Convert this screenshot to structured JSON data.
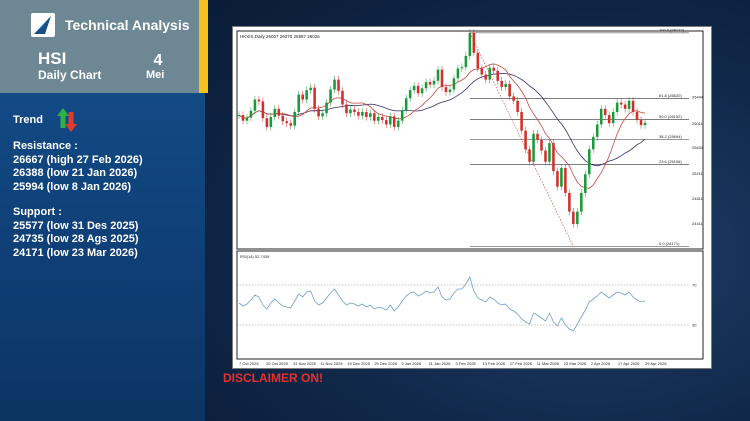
{
  "header": {
    "brand": "Technical Analysis",
    "ticker": "HSI",
    "chart_type": "Daily Chart",
    "day": "4",
    "month": "Mei"
  },
  "trend": {
    "label": "Trend",
    "up_color": "#2eaf49",
    "down_color": "#e23a2d"
  },
  "resistance": {
    "title": "Resistance :",
    "levels": [
      "26667 (high 27 Feb 2026)",
      "26388 (low 21 Jan 2026)",
      "25994 (low 8 Jan 2026)"
    ]
  },
  "support": {
    "title": "Support :",
    "levels": [
      "25577 (low 31 Des 2025)",
      "24735 (low 28 Ags 2025)",
      "24171 (low 23 Mar 2026)"
    ]
  },
  "disclaimer": "DISCLAIMER ON!",
  "chart_data": {
    "type": "candlestick",
    "title": "HKXIS,Daily 26007 26070 25987 26026",
    "x_ticks": [
      "7 Oct 2025",
      "20 Oct 2025",
      "31 Nov 2025",
      "11 Nov 2025",
      "19 Dec 2025",
      "29 Dec 2025",
      "9 Jan 2026",
      "21 Jan 2026",
      "3 Feb 2026",
      "13 Feb 2026",
      "27 Feb 2026",
      "11 Mar 2026",
      "23 Mar 2026",
      "2 Apr 2026",
      "17 Apr 2026",
      "29 Apr 2026"
    ],
    "ylim": [
      24000,
      27500
    ],
    "fib_levels": [
      {
        "label": "100.0 (28172)",
        "value": 27470
      },
      {
        "label": "61.8 (26620)",
        "value": 26420
      },
      {
        "label": "50.0 (26152)",
        "value": 26080
      },
      {
        "label": "38.2 (25694)",
        "value": 25760
      },
      {
        "label": "23.6 (25106)",
        "value": 25360
      },
      {
        "label": "0.0 (24171)",
        "value": 24040
      }
    ],
    "price_labels": [
      "26444",
      "26011",
      "25631",
      "25211",
      "24811",
      "24411"
    ],
    "close": [
      26150,
      26060,
      26110,
      26220,
      26400,
      26370,
      26100,
      25960,
      26120,
      26250,
      26140,
      26050,
      26020,
      25980,
      26200,
      26480,
      26400,
      26550,
      26590,
      26250,
      26130,
      26180,
      26350,
      26560,
      26720,
      26540,
      26320,
      26180,
      26240,
      26200,
      26140,
      26200,
      26120,
      26180,
      26060,
      26120,
      26070,
      26000,
      26130,
      25960,
      26060,
      26230,
      26420,
      26550,
      26620,
      26500,
      26580,
      26680,
      26640,
      26700,
      26880,
      26600,
      26520,
      26560,
      26740,
      26900,
      26920,
      27100,
      27470,
      27150,
      26900,
      26800,
      26720,
      26910,
      26860,
      26700,
      26600,
      26650,
      26450,
      26380,
      26200,
      25900,
      25600,
      25400,
      25850,
      25750,
      25580,
      25400,
      25700,
      25250,
      25000,
      25300,
      24900,
      24600,
      24400,
      24600,
      24900,
      25200,
      25600,
      25800,
      26000,
      26250,
      26150,
      26020,
      26200,
      26350,
      26320,
      26250,
      26380,
      26200,
      26070,
      25990,
      26026
    ],
    "rsi": {
      "label": "RSI(14) 52.7439",
      "ylim": [
        0,
        100
      ],
      "levels": [
        70,
        30
      ],
      "values": [
        52,
        49,
        51,
        55,
        60,
        58,
        50,
        46,
        52,
        56,
        52,
        49,
        48,
        47,
        54,
        61,
        58,
        63,
        64,
        54,
        50,
        52,
        57,
        62,
        66,
        60,
        54,
        50,
        52,
        51,
        49,
        51,
        48,
        50,
        46,
        48,
        47,
        45,
        50,
        44,
        48,
        54,
        59,
        62,
        63,
        59,
        61,
        64,
        62,
        63,
        68,
        58,
        55,
        56,
        62,
        66,
        66,
        71,
        78,
        64,
        57,
        55,
        53,
        58,
        56,
        52,
        50,
        51,
        46,
        44,
        41,
        36,
        33,
        31,
        42,
        40,
        37,
        34,
        42,
        33,
        29,
        37,
        30,
        26,
        24,
        31,
        38,
        45,
        53,
        56,
        59,
        63,
        60,
        57,
        60,
        63,
        62,
        60,
        63,
        58,
        55,
        53,
        54
      ]
    }
  }
}
